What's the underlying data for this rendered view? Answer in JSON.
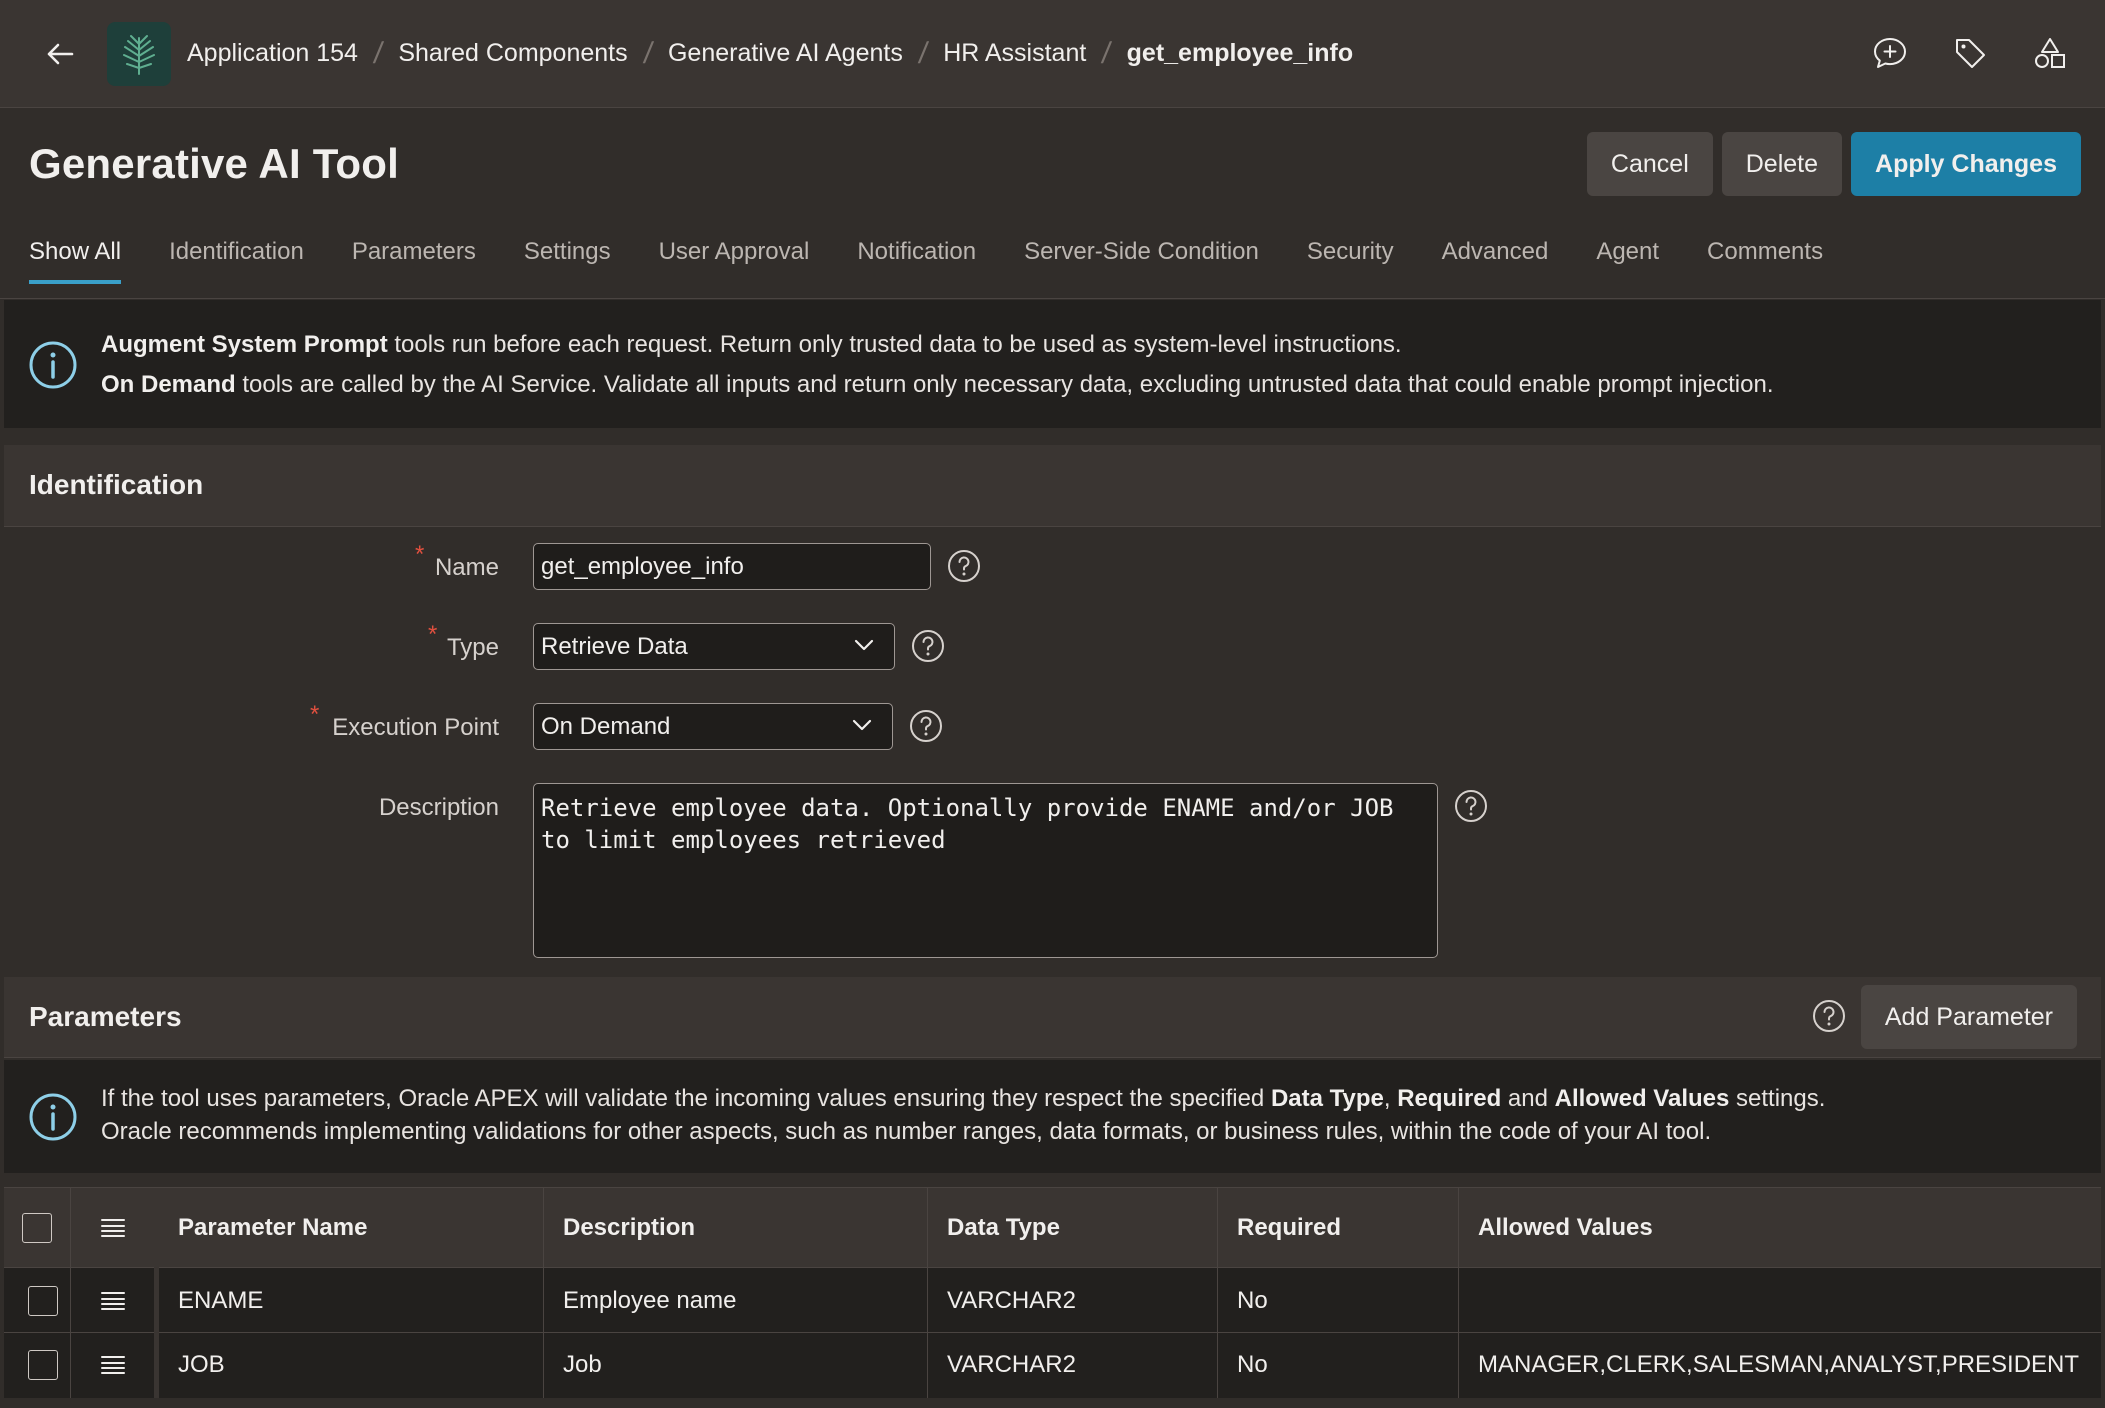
{
  "breadcrumb": {
    "items": [
      "Application 154",
      "Shared Components",
      "Generative AI Agents",
      "HR Assistant"
    ],
    "current": "get_employee_info"
  },
  "header": {
    "title": "Generative AI Tool",
    "buttons": {
      "cancel": "Cancel",
      "delete": "Delete",
      "apply": "Apply Changes"
    }
  },
  "tabs": [
    "Show All",
    "Identification",
    "Parameters",
    "Settings",
    "User Approval",
    "Notification",
    "Server-Side Condition",
    "Security",
    "Advanced",
    "Agent",
    "Comments"
  ],
  "active_tab": "Show All",
  "info_banner": {
    "line1_bold": "Augment System Prompt",
    "line1_rest": " tools run before each request. Return only trusted data to be used as system-level instructions.",
    "line2_bold": "On Demand",
    "line2_rest": " tools are called by the AI Service. Validate all inputs and return only necessary data, excluding untrusted data that could enable prompt injection."
  },
  "identification": {
    "title": "Identification",
    "name_label": "Name",
    "name_value": "get_employee_info",
    "type_label": "Type",
    "type_value": "Retrieve Data",
    "exec_label": "Execution Point",
    "exec_value": "On Demand",
    "desc_label": "Description",
    "desc_value": "Retrieve employee data. Optionally provide ENAME and/or JOB\nto limit employees retrieved",
    "required_mark": "*"
  },
  "parameters": {
    "title": "Parameters",
    "add_button": "Add Parameter",
    "info_t1": "If the tool uses parameters, Oracle APEX will validate the incoming values ensuring they respect the specified ",
    "info_b1": "Data Type",
    "info_t2": ", ",
    "info_b2": "Required",
    "info_t3": " and ",
    "info_b3": "Allowed Values",
    "info_t4": " settings.",
    "info_line2": "Oracle recommends implementing validations for other aspects, such as number ranges, data formats, or business rules, within the code of your AI tool.",
    "columns": [
      "Parameter Name",
      "Description",
      "Data Type",
      "Required",
      "Allowed Values"
    ],
    "rows": [
      [
        "ENAME",
        "Employee name",
        "VARCHAR2",
        "No",
        ""
      ],
      [
        "JOB",
        "Job",
        "VARCHAR2",
        "No",
        "MANAGER,CLERK,SALESMAN,ANALYST,PRESIDENT"
      ]
    ]
  }
}
